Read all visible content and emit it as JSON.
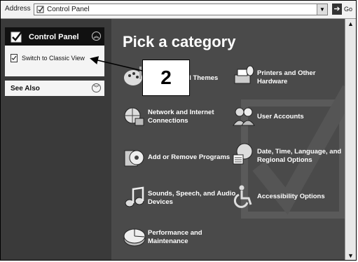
{
  "address_bar": {
    "label": "Address",
    "value": "Control Panel",
    "go_label": "Go"
  },
  "left_pane": {
    "panel_title": "Control Panel",
    "switch_link": "Switch to Classic View",
    "see_also": "See Also"
  },
  "main": {
    "title": "Pick a category",
    "categories": [
      {
        "label": "Appearance and Themes",
        "visible_label": "d Themes",
        "icon": "paint-palette-icon"
      },
      {
        "label": "Printers and Other Hardware",
        "icon": "printer-icon"
      },
      {
        "label": "Network and Internet Connections",
        "icon": "globe-network-icon"
      },
      {
        "label": "User Accounts",
        "icon": "users-icon"
      },
      {
        "label": "Add or Remove Programs",
        "icon": "cd-box-icon"
      },
      {
        "label": "Date, Time, Language, and Regional Options",
        "icon": "globe-calendar-icon"
      },
      {
        "label": "Sounds, Speech, and Audio Devices",
        "icon": "music-notes-icon"
      },
      {
        "label": "Accessibility Options",
        "icon": "wheelchair-icon"
      },
      {
        "label": "Performance and Maintenance",
        "icon": "pie-chart-icon"
      }
    ]
  },
  "callout": {
    "number": "2"
  }
}
